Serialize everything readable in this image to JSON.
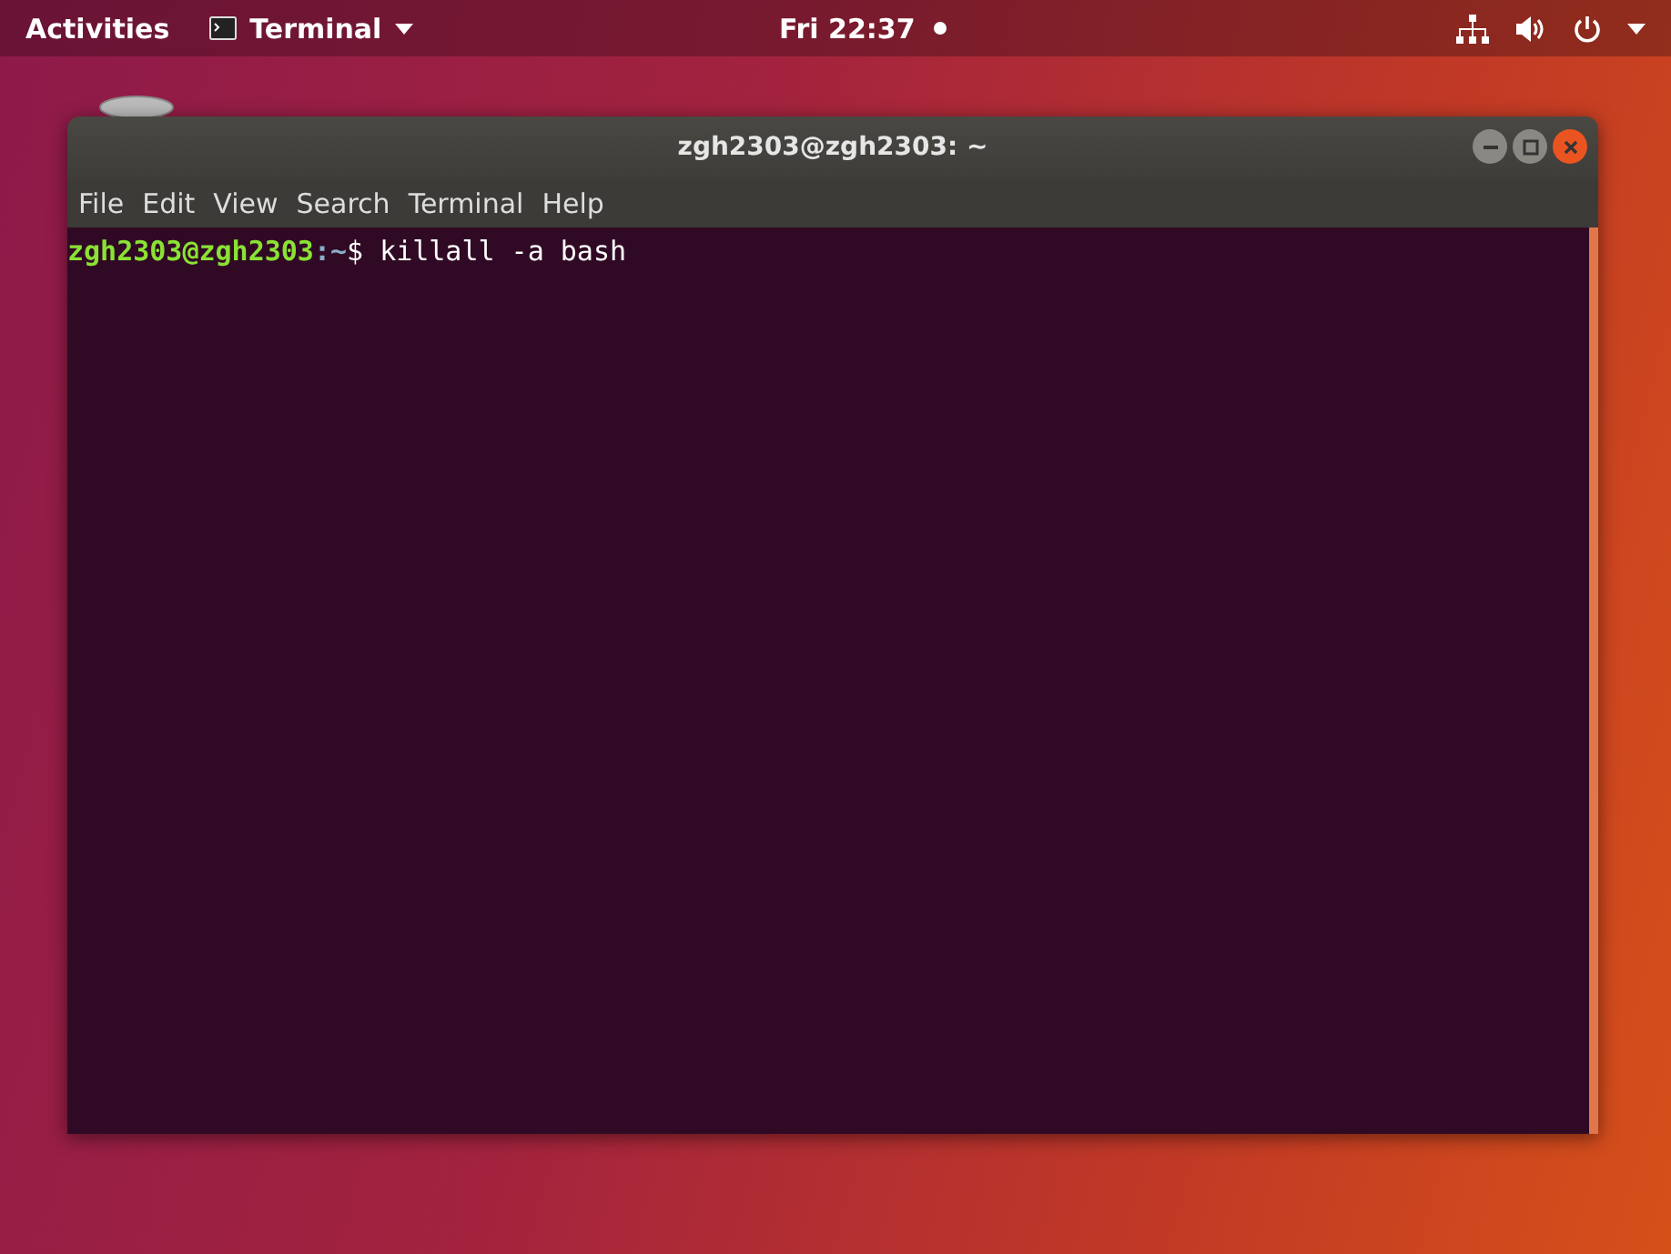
{
  "top_bar": {
    "activities": "Activities",
    "app_menu": "Terminal",
    "clock": "Fri 22:37"
  },
  "window": {
    "title": "zgh2303@zgh2303: ~",
    "menu": [
      "File",
      "Edit",
      "View",
      "Search",
      "Terminal",
      "Help"
    ],
    "lines": [
      {
        "user": "zgh2303@zgh2303",
        "path": ":~",
        "symbol": "$",
        "command": "killall -a bash"
      }
    ]
  }
}
